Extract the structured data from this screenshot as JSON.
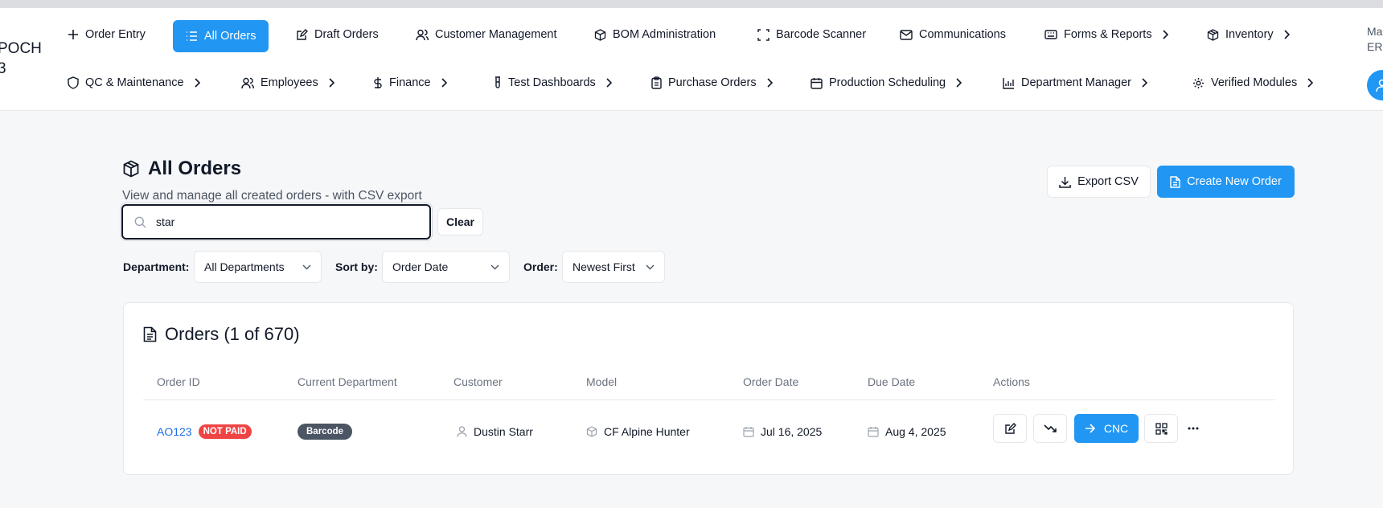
{
  "app": {
    "logo_line1": "POCH",
    "logo_line2": "3",
    "user_line1": "Ma",
    "user_line2": "ERF"
  },
  "nav": {
    "row1": [
      {
        "label": "Order Entry",
        "icon": "plus-icon"
      },
      {
        "label": "All Orders",
        "icon": "list-icon",
        "active": true
      },
      {
        "label": "Draft Orders",
        "icon": "edit-icon"
      },
      {
        "label": "Customer Management",
        "icon": "users-icon"
      },
      {
        "label": "BOM Administration",
        "icon": "box-icon"
      },
      {
        "label": "Barcode Scanner",
        "icon": "scan-icon"
      },
      {
        "label": "Communications",
        "icon": "mail-icon"
      },
      {
        "label": "Forms & Reports",
        "icon": "keyboard-icon"
      },
      {
        "label": "Inventory",
        "icon": "package-icon"
      }
    ],
    "row2": [
      {
        "label": "QC & Maintenance",
        "icon": "shield-icon"
      },
      {
        "label": "Employees",
        "icon": "users-icon"
      },
      {
        "label": "Finance",
        "icon": "dollar-icon"
      },
      {
        "label": "Test Dashboards",
        "icon": "test-tube-icon"
      },
      {
        "label": "Purchase Orders",
        "icon": "clipboard-icon"
      },
      {
        "label": "Production Scheduling",
        "icon": "calendar-icon"
      },
      {
        "label": "Department Manager",
        "icon": "chart-icon"
      },
      {
        "label": "Verified Modules",
        "icon": "gear-icon"
      }
    ]
  },
  "page": {
    "title": "All Orders",
    "subtitle": "View and manage all created orders - with CSV export",
    "export_label": "Export CSV",
    "create_label": "Create New Order"
  },
  "search": {
    "value": "star",
    "clear_label": "Clear"
  },
  "filters": {
    "department_label": "Department:",
    "department_value": "All Departments",
    "sort_label": "Sort by:",
    "sort_value": "Order Date",
    "order_label": "Order:",
    "order_value": "Newest First"
  },
  "orders": {
    "title": "Orders (1 of 670)",
    "columns": [
      "Order ID",
      "Current Department",
      "Customer",
      "Model",
      "Order Date",
      "Due Date",
      "Actions"
    ],
    "rows": [
      {
        "order_id": "AO123",
        "payment_badge": "NOT PAID",
        "department": "Barcode",
        "customer": "Dustin Starr",
        "model": "CF Alpine Hunter",
        "order_date": "Jul 16, 2025",
        "due_date": "Aug 4, 2025",
        "next_dept_label": "CNC"
      }
    ]
  },
  "colors": {
    "accent": "#2196f3",
    "danger": "#ef4444",
    "dept_badge": "#4b5563",
    "link": "#1d6fe0"
  }
}
